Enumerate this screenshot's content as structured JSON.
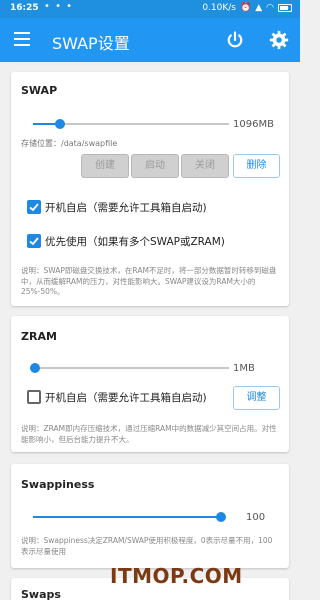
{
  "status_bar": {
    "time": "16:25",
    "dots": "• • •",
    "speed": "0.10K/s",
    "battery_icon": "battery-icon"
  },
  "app_bar": {
    "title": "SWAP设置",
    "menu_icon": "menu-icon",
    "power_icon": "power-icon",
    "settings_icon": "gear-icon",
    "color": "#2196f3"
  },
  "swap": {
    "title": "SWAP",
    "slider_fraction": 0.14,
    "size_value": "1096MB",
    "path": "存储位置：/data/swapfile",
    "buttons": {
      "create": "创建",
      "start": "启动",
      "stop": "关闭",
      "delete": "删除"
    },
    "checkbox_autostart": {
      "label": "开机自启（需要允许工具箱自启动)",
      "checked": true
    },
    "checkbox_priority": {
      "label": "优先使用（如果有多个SWAP或ZRAM)",
      "checked": true
    },
    "description": "说明：SWAP即磁盘交换技术，在RAM不足时，将一部分数据暂时转移到磁盘中，从而缓解RAM的压力，对性能影响大。SWAP建议设为RAM大小的25%-50%。"
  },
  "zram": {
    "title": "ZRAM",
    "slider_fraction": 0.01,
    "size_value": "1MB",
    "checkbox_autostart": {
      "label": "开机自启（需要允许工具箱自启动)",
      "checked": false
    },
    "adjust_button": "调整",
    "description": "说明：ZRAM即内存压缩技术，通过压缩RAM中的数据减少其空间占用。对性能影响小，但后台能力提升不大。"
  },
  "swappiness": {
    "title": "Swappiness",
    "slider_fraction": 1.0,
    "value": "100",
    "description": "说明：Swappiness决定ZRAM/SWAP使用积极程度，0表示尽量不用，100表示尽量使用"
  },
  "swaps": {
    "title": "Swaps"
  },
  "watermark": "ITMOP.COM"
}
